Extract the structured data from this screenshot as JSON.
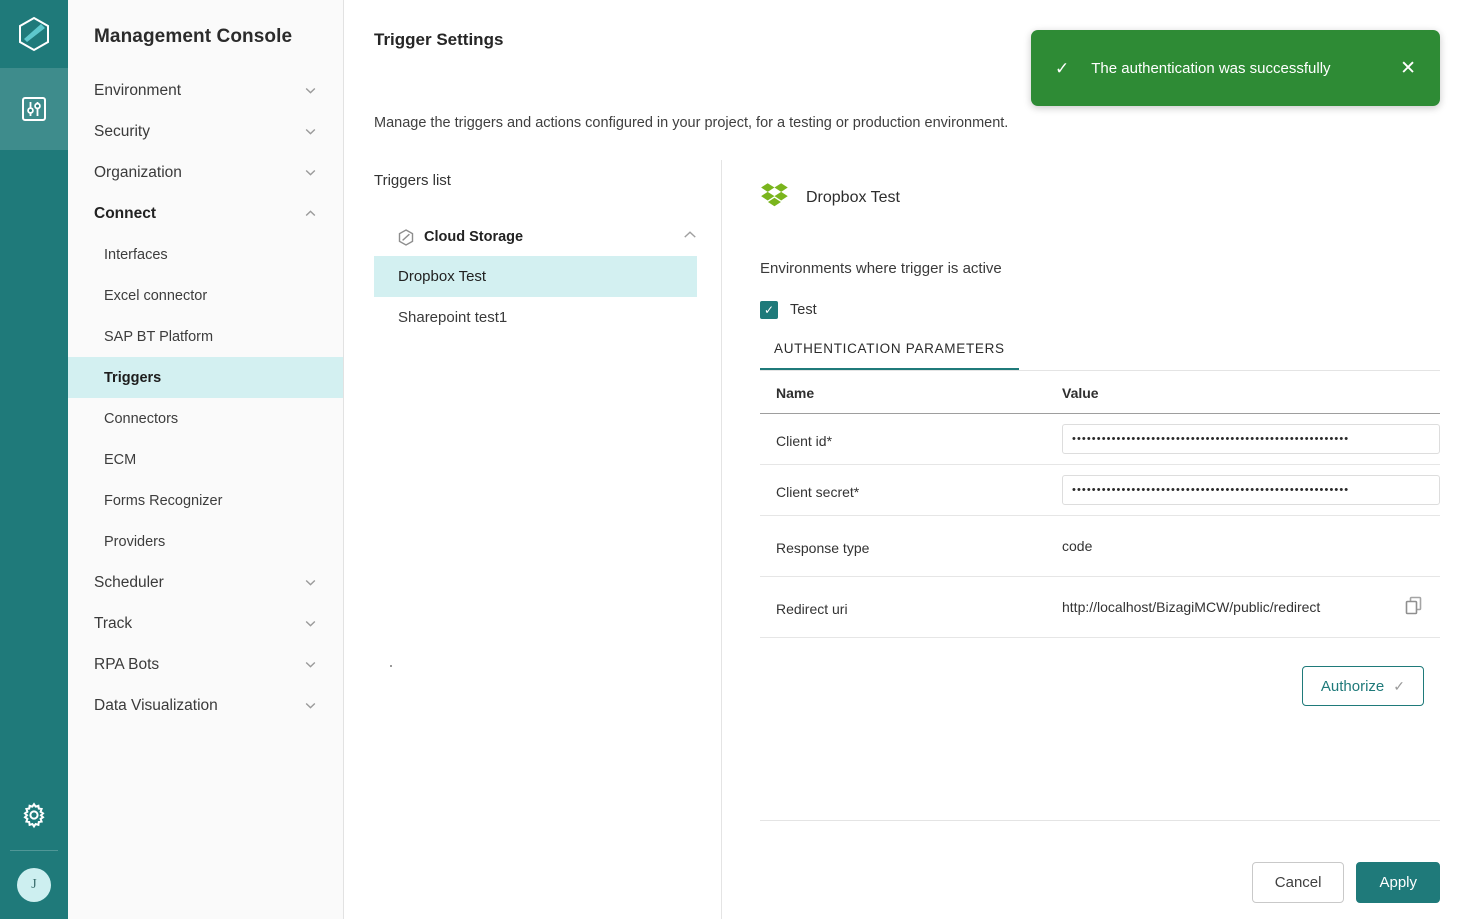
{
  "rail": {
    "logo_icon": "hexagon-logo-icon",
    "items": [
      {
        "icon": "sliders-icon",
        "name": "settings-panel",
        "active": true
      }
    ],
    "gear_icon": "gear-icon",
    "avatar_initial": "J"
  },
  "sidebar": {
    "title": "Management Console",
    "items": [
      {
        "label": "Environment",
        "type": "group",
        "expanded": false
      },
      {
        "label": "Security",
        "type": "group",
        "expanded": false
      },
      {
        "label": "Organization",
        "type": "group",
        "expanded": false
      },
      {
        "label": "Connect",
        "type": "group",
        "expanded": true
      },
      {
        "label": "Interfaces",
        "type": "sub",
        "active": false
      },
      {
        "label": "Excel connector",
        "type": "sub",
        "active": false
      },
      {
        "label": "SAP BT Platform",
        "type": "sub",
        "active": false
      },
      {
        "label": "Triggers",
        "type": "sub",
        "active": true
      },
      {
        "label": "Connectors",
        "type": "sub",
        "active": false
      },
      {
        "label": "ECM",
        "type": "sub",
        "active": false
      },
      {
        "label": "Forms Recognizer",
        "type": "sub",
        "active": false
      },
      {
        "label": "Providers",
        "type": "sub",
        "active": false
      },
      {
        "label": "Scheduler",
        "type": "group",
        "expanded": false
      },
      {
        "label": "Track",
        "type": "group",
        "expanded": false
      },
      {
        "label": "RPA Bots",
        "type": "group",
        "expanded": false
      },
      {
        "label": "Data Visualization",
        "type": "group",
        "expanded": false
      }
    ]
  },
  "page": {
    "title": "Trigger Settings",
    "description": "Manage the triggers and actions configured in your project, for a testing or production environment."
  },
  "toast": {
    "message": "The authentication was successfully",
    "check_icon": "check-icon",
    "close_icon": "close-icon",
    "color": "#2E8B35"
  },
  "triggers_list": {
    "title": "Triggers list",
    "group": {
      "label": "Cloud Storage",
      "icon": "cloud-storage-hexagon-icon",
      "chevron": "chevron-up-icon",
      "expanded": true
    },
    "items": [
      {
        "label": "Dropbox Test",
        "active": true
      },
      {
        "label": "Sharepoint test1",
        "active": false
      }
    ]
  },
  "detail": {
    "icon": "dropbox-icon",
    "icon_color": "#7AB51D",
    "name": "Dropbox Test",
    "environments_label": "Environments where trigger is active",
    "environment_checkbox": {
      "label": "Test",
      "checked": true
    },
    "tabs": [
      {
        "label": "AUTHENTICATION PARAMETERS",
        "active": true
      }
    ],
    "table": {
      "columns": [
        "Name",
        "Value"
      ],
      "rows": [
        {
          "name": "Client id*",
          "value": "••••••••••••••••••••••••••••••••••••••••••••••••••••••••",
          "type": "password"
        },
        {
          "name": "Client secret*",
          "value": "••••••••••••••••••••••••••••••••••••••••••••••••••••••••",
          "type": "password"
        },
        {
          "name": "Response type",
          "value": "code",
          "type": "text"
        },
        {
          "name": "Redirect uri",
          "value": "http://localhost/BizagiMCW/public/redirect",
          "type": "text",
          "copy_icon": "copy-icon"
        }
      ]
    },
    "authorize_button": {
      "label": "Authorize",
      "check_icon": "check-icon"
    }
  },
  "footer": {
    "cancel_label": "Cancel",
    "apply_label": "Apply"
  },
  "theme": {
    "teal": "#1F7A7A",
    "teal_light": "#3E8C8C",
    "highlight": "#D3F0F1",
    "success_green": "#2E8B35"
  }
}
